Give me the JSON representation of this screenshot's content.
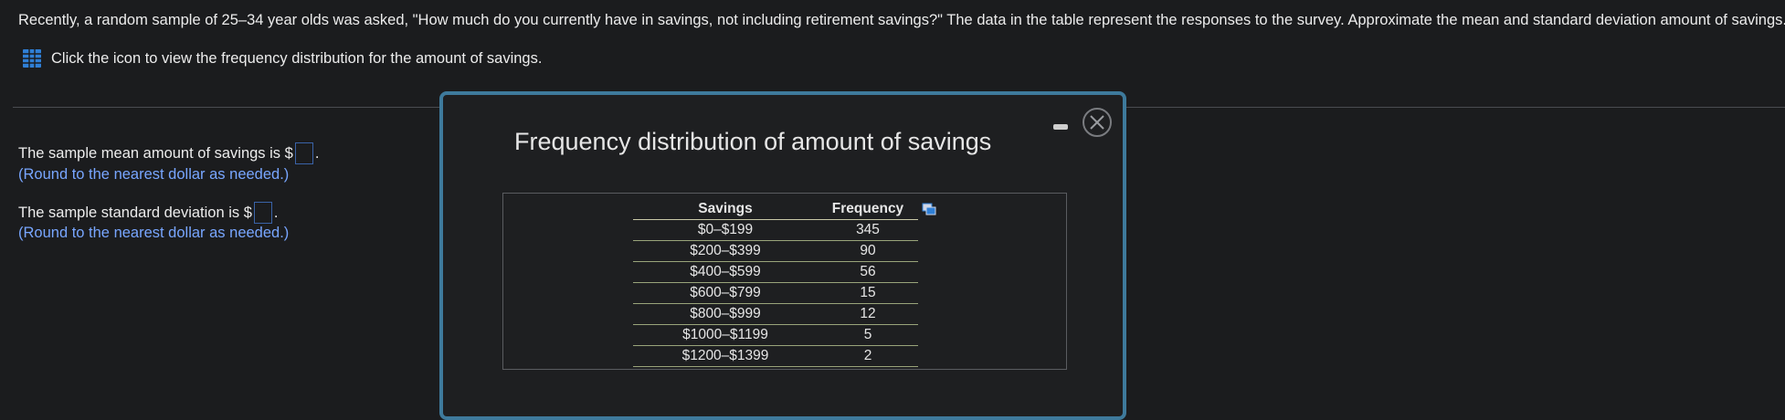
{
  "question": {
    "text": "Recently, a random sample of 25–34 year olds was asked, \"How much do you currently have in savings, not including retirement savings?\" The data in the table represent the responses to the survey. Approximate the mean and standard deviation amount of savings.",
    "hint": "Click the icon to view the frequency distribution for the amount of savings."
  },
  "answers": {
    "mean_label": "The sample mean amount of savings is $",
    "mean_value": "",
    "mean_suffix": ".",
    "mean_note": "(Round to the nearest dollar as needed.)",
    "sd_label": "The sample standard deviation is $",
    "sd_value": "",
    "sd_suffix": ".",
    "sd_note": "(Round to the nearest dollar as needed.)"
  },
  "modal": {
    "title": "Frequency distribution of amount of savings",
    "table": {
      "headers": [
        "Savings",
        "Frequency"
      ],
      "rows": [
        [
          "$0–$199",
          "345"
        ],
        [
          "$200–$399",
          "90"
        ],
        [
          "$400–$599",
          "56"
        ],
        [
          "$600–$799",
          "15"
        ],
        [
          "$800–$999",
          "12"
        ],
        [
          "$1000–$1199",
          "5"
        ],
        [
          "$1200–$1399",
          "2"
        ]
      ]
    }
  },
  "icons": {
    "table_icon": "grid-icon",
    "copy_icon": "copy-icon",
    "minimize": "minimize-icon",
    "close": "close-icon"
  },
  "colors": {
    "background": "#1b1c1e",
    "note": "#78a6ff",
    "modal_border": "#3e7a9c",
    "icon_blue": "#2f7fd6"
  }
}
